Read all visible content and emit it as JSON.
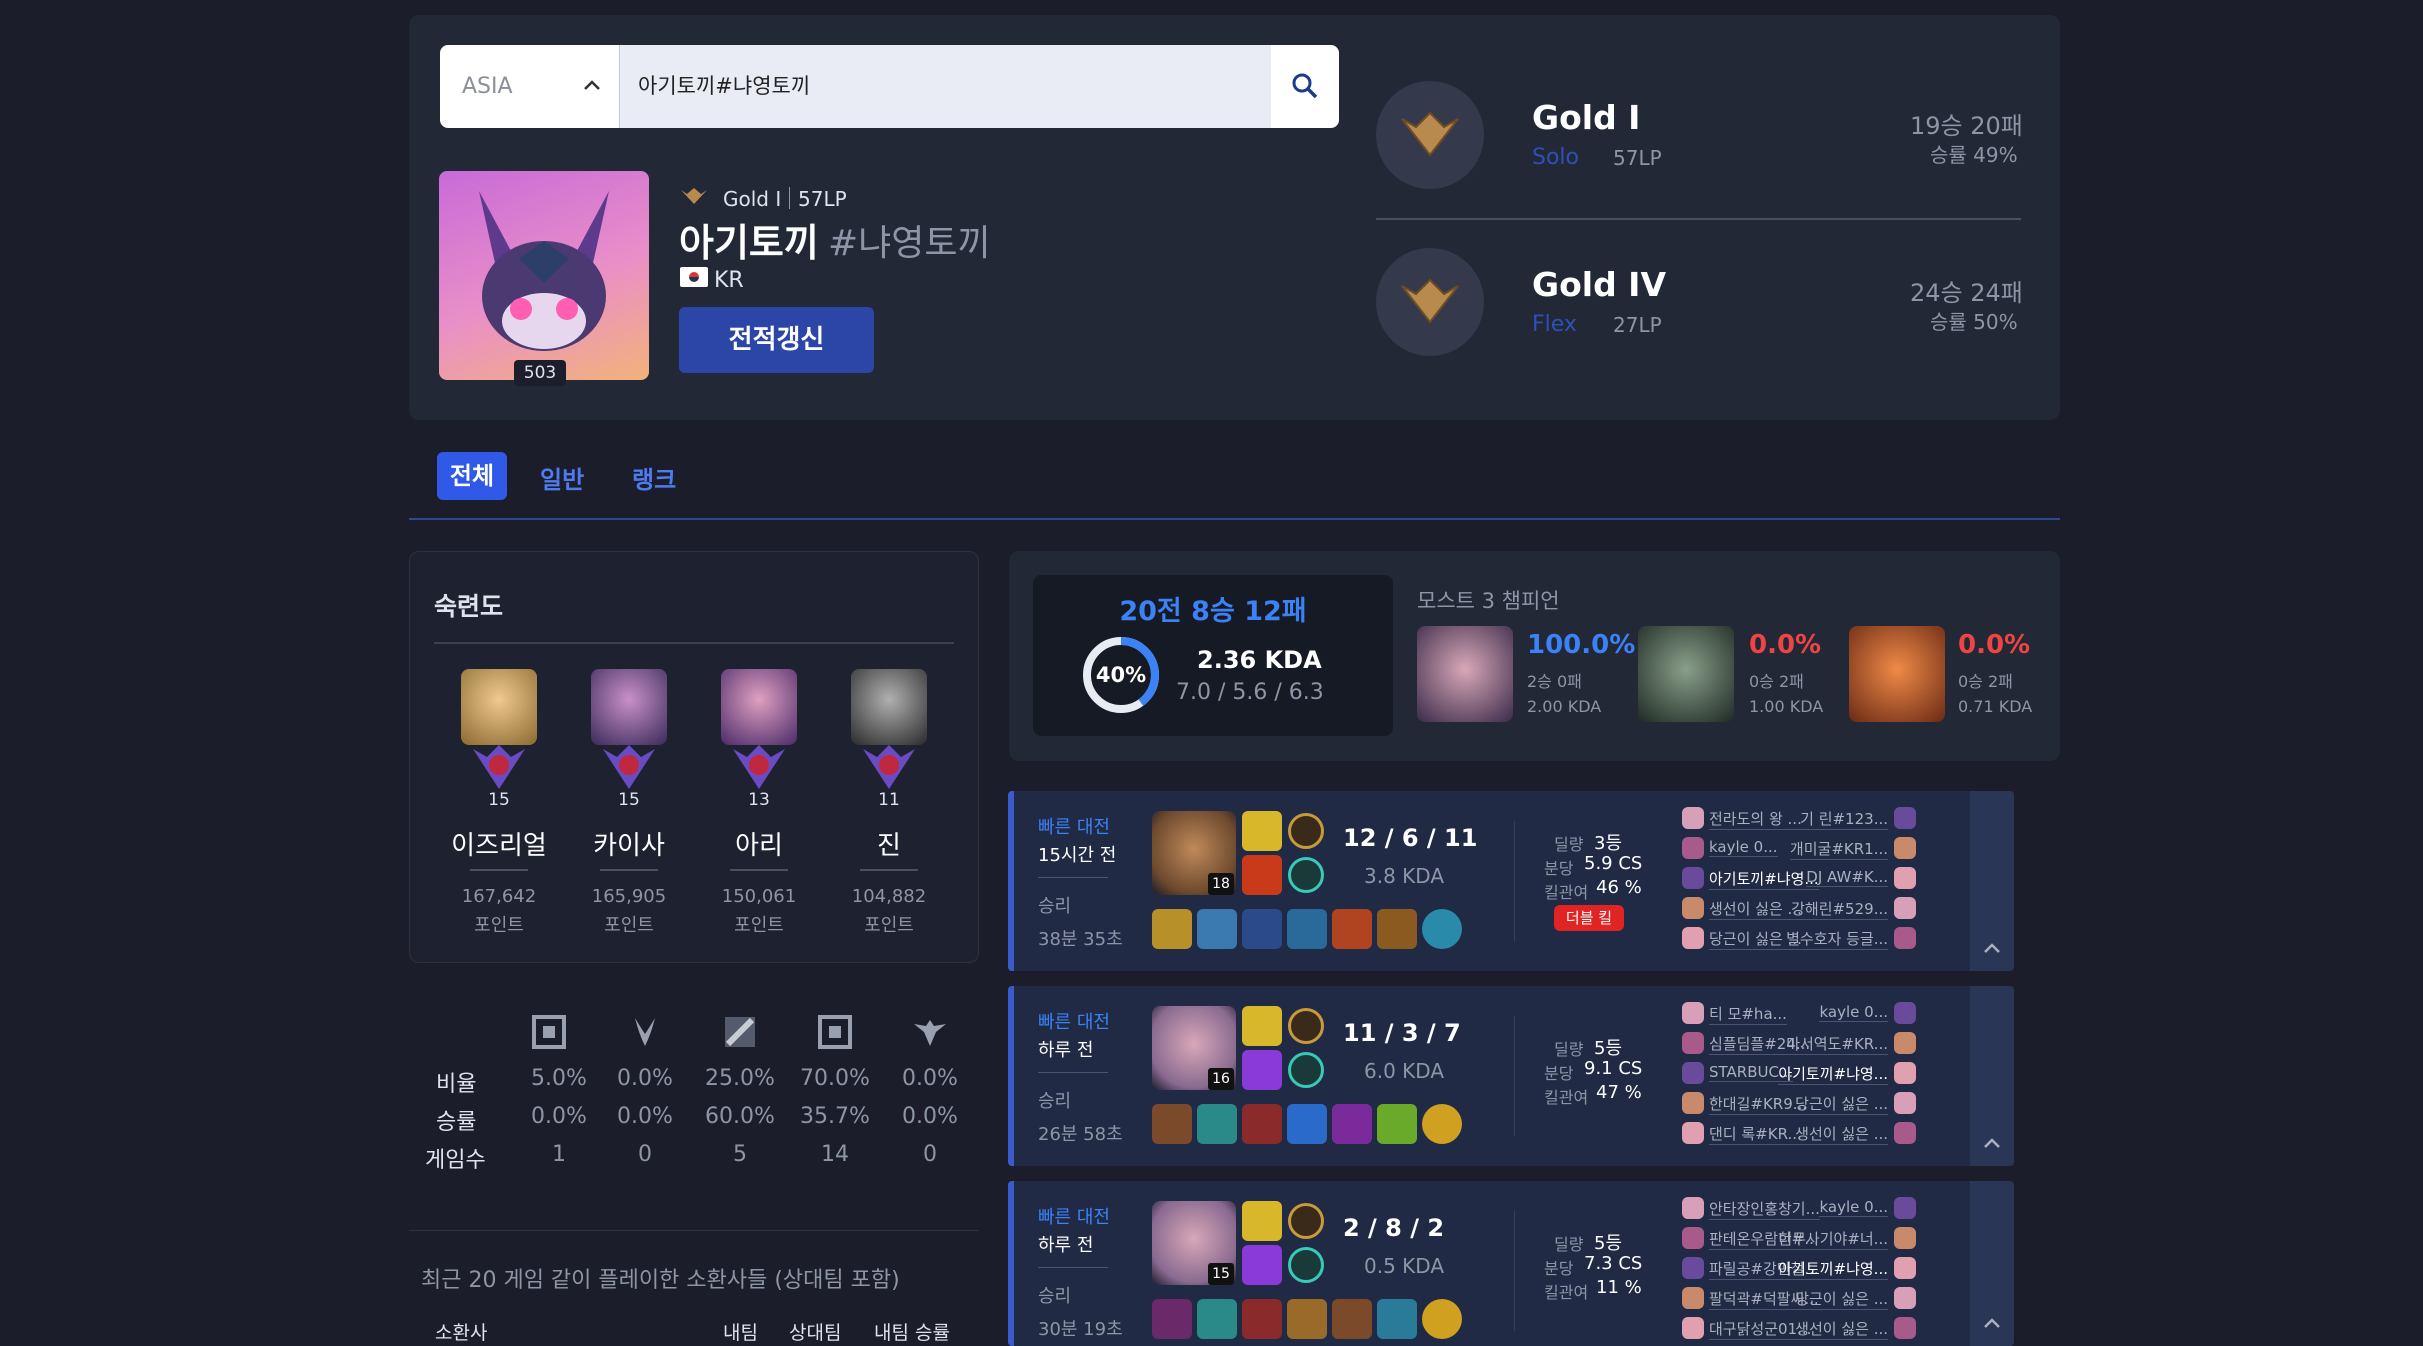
{
  "search": {
    "region": "ASIA",
    "value": "아기토끼#냐영토끼"
  },
  "profile": {
    "level": "503",
    "rank_line_tier": "Gold I",
    "rank_line_lp": "57LP",
    "name": "아기토끼",
    "tag": "#냐영토끼",
    "country": "KR",
    "refresh_label": "전적갱신"
  },
  "ranks": [
    {
      "tier": "Gold I",
      "queue": "Solo",
      "lp": "57LP",
      "record": "19승 20패",
      "winrate": "승률 49%"
    },
    {
      "tier": "Gold IV",
      "queue": "Flex",
      "lp": "27LP",
      "record": "24승 24패",
      "winrate": "승률 50%"
    }
  ],
  "tabs": [
    "전체",
    "일반",
    "랭크"
  ],
  "mastery": {
    "title": "숙련도",
    "items": [
      {
        "level": "15",
        "name": "이즈리얼",
        "points": "167,642",
        "unit": "포인트",
        "color": "#d8a44a"
      },
      {
        "level": "15",
        "name": "카이사",
        "points": "165,905",
        "unit": "포인트",
        "color": "#7a5a9a"
      },
      {
        "level": "13",
        "name": "아리",
        "points": "150,061",
        "unit": "포인트",
        "color": "#6a4a8a"
      },
      {
        "level": "11",
        "name": "진",
        "points": "104,882",
        "unit": "포인트",
        "color": "#8a8a8a"
      }
    ]
  },
  "positions": {
    "rows": [
      {
        "label": "비율",
        "values": [
          "5.0%",
          "0.0%",
          "25.0%",
          "70.0%",
          "0.0%"
        ]
      },
      {
        "label": "승률",
        "values": [
          "0.0%",
          "0.0%",
          "60.0%",
          "35.7%",
          "0.0%"
        ]
      },
      {
        "label": "게임수",
        "values": [
          "1",
          "0",
          "5",
          "14",
          "0"
        ]
      }
    ]
  },
  "recent_players": {
    "title": "최근 20 게임 같이 플레이한 소환사들 (상대팀 포함)",
    "headers": [
      "소환사",
      "내팀",
      "상대팀",
      "내팀 승률"
    ]
  },
  "summary": {
    "record": "20전 8승 12패",
    "winrate": "40%",
    "winrate_value": 40,
    "kda": "2.36 KDA",
    "kda_detail": "7.0 / 5.6 / 6.3",
    "most_title": "모스트 3 챔피언",
    "most": [
      {
        "rate": "100.0%",
        "record": "2승 0패",
        "kda": "2.00 KDA",
        "color": "#3b82f6",
        "face": "#b58aa8"
      },
      {
        "rate": "0.0%",
        "record": "0승 2패",
        "kda": "1.00 KDA",
        "color": "#ef4444",
        "face": "#4e6a58"
      },
      {
        "rate": "0.0%",
        "record": "0승 2패",
        "kda": "0.71 KDA",
        "color": "#ef4444",
        "face": "#d26a38"
      }
    ]
  },
  "matches": [
    {
      "mode": "빠른 대전",
      "time": "15시간 전",
      "result": "승리",
      "duration": "38분 35초",
      "level": "18",
      "kda": "12 / 6 / 11",
      "kda_ratio": "3.8 KDA",
      "rank_label": "딜량",
      "rank": "3등",
      "cs_label": "분당",
      "cs": "5.9 CS",
      "kp_label": "킬관여",
      "kp": "46 %",
      "badge": "더블 킬",
      "champ": "#6e4a2e",
      "team1": [
        "전라도의 왕 ...",
        "kayle 0...",
        "아기토끼#냐영...",
        "생선이 싫은 ...",
        "당근이 싫은 ..."
      ],
      "team2": [
        "기 린#123...",
        "개미굴#KR1...",
        "DJ AW#K...",
        "강해린#529...",
        "별수호자 등글..."
      ]
    },
    {
      "mode": "빠른 대전",
      "time": "하루 전",
      "result": "승리",
      "duration": "26분 58초",
      "level": "16",
      "kda": "11 / 3 / 7",
      "kda_ratio": "6.0 KDA",
      "rank_label": "딜량",
      "rank": "5등",
      "cs_label": "분당",
      "cs": "9.1 CS",
      "kp_label": "킬관여",
      "kp": "47 %",
      "badge": "",
      "champ": "#8a6a90",
      "team1": [
        "티 모#ha...",
        "심플딤플#24...",
        "STARBUC...",
        "한대길#KR9...",
        "댄디 록#KR..."
      ],
      "team2": [
        "kayle 0...",
        "마서역도#KR...",
        "아기토끼#냐영...",
        "당근이 싫은 ...",
        "생선이 싫은 ..."
      ]
    },
    {
      "mode": "빠른 대전",
      "time": "하루 전",
      "result": "승리",
      "duration": "30분 19초",
      "level": "15",
      "kda": "2 / 8 / 2",
      "kda_ratio": "0.5 KDA",
      "rank_label": "딜량",
      "rank": "5등",
      "cs_label": "분당",
      "cs": "7.3 CS",
      "kp_label": "킬관여",
      "kp": "11 %",
      "badge": "",
      "champ": "#8a6a90",
      "team1": [
        "안타장인홍창기...",
        "판테온우람한#...",
        "파릴공#강민철...",
        "팔덕곽#덕팔씨...",
        "대구닭성군01..."
      ],
      "team2": [
        "kayle 0...",
        "너무사기야#너...",
        "아기토끼#냐영...",
        "당근이 싫은 ...",
        "생선이 싫은 ..."
      ]
    }
  ]
}
